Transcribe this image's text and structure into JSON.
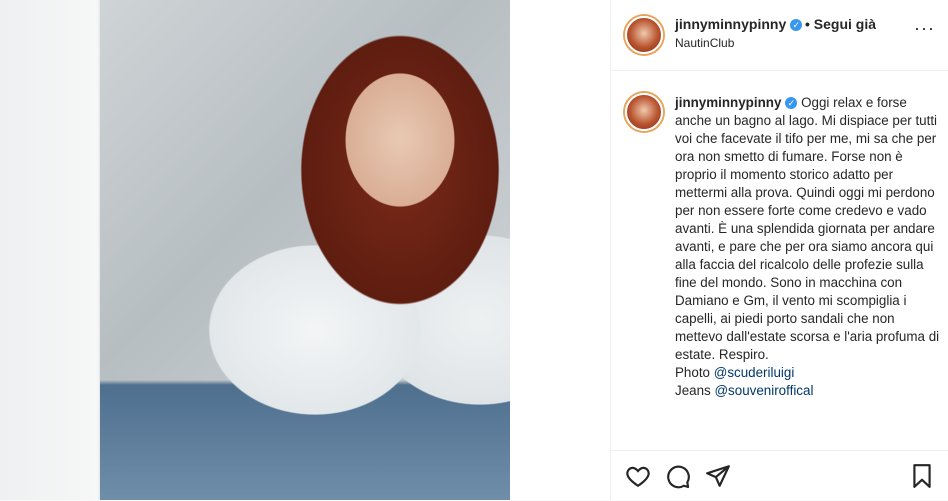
{
  "post": {
    "username": "jinnyminnypinny",
    "follow_label": "• Segui già",
    "location": "NautinClub",
    "more_label": "···"
  },
  "caption": {
    "username": "jinnyminnypinny",
    "text": "Oggi relax e forse anche un bagno al lago. Mi dispiace per tutti voi che facevate il tifo per me, mi sa che per ora non smetto di fumare. Forse non è proprio il momento storico adatto per mettermi alla prova. Quindi oggi mi perdono per non essere forte come credevo e vado avanti. È una splendida giornata per andare avanti, e pare che per ora siamo ancora qui alla faccia del ricalcolo delle profezie sulla fine del mondo. Sono in macchina con Damiano e Gm, il vento mi scompiglia i capelli, ai piedi porto sandali che non mettevo dall'estate scorsa e l'aria profuma di estate. Respiro.",
    "photo_label": "Photo",
    "photo_mention": "@scuderiluigi",
    "jeans_label": "Jeans",
    "jeans_mention": "@souveniroffical"
  },
  "icons": {
    "verified": "verified-icon",
    "like": "heart-icon",
    "comment": "comment-icon",
    "share": "send-icon",
    "save": "bookmark-icon"
  },
  "colors": {
    "accent_blue": "#3897f0",
    "mention": "#00376b",
    "text": "#262626",
    "border": "#efefef"
  }
}
